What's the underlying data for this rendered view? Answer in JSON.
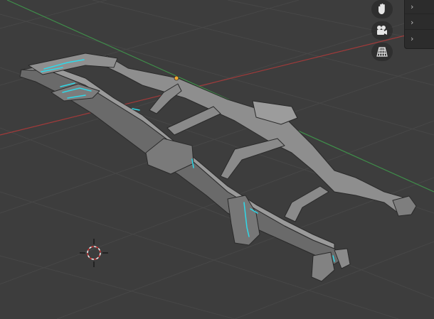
{
  "viewport": {
    "colors": {
      "background": "#3d3d3d",
      "grid": "#474747",
      "x_axis": "#a23a3a",
      "y_axis": "#3f8f4a",
      "mesh_light": "#9a9a9a",
      "mesh_dark": "#5e5e5e",
      "mesh_edge": "#2a2a2a",
      "seam": "#2fd8e8",
      "origin_point": "#f0a830"
    }
  },
  "nav_gizmo": {
    "items": [
      {
        "name": "pan",
        "icon": "hand-icon"
      },
      {
        "name": "camera-view",
        "icon": "camera-icon"
      },
      {
        "name": "toggle-perspective",
        "icon": "grid-icon"
      }
    ]
  },
  "side_tabs": {
    "items": [
      {
        "glyph": "›"
      },
      {
        "glyph": "›"
      },
      {
        "glyph": "›"
      }
    ]
  }
}
